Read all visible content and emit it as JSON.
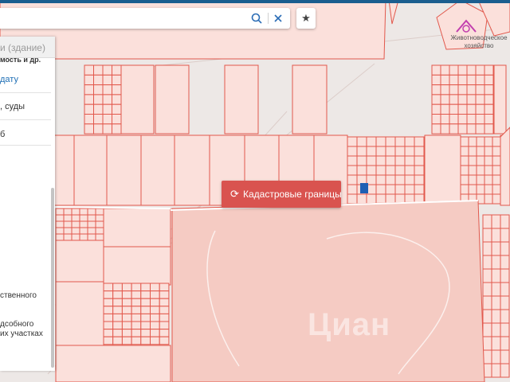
{
  "map": {
    "colors": {
      "background": "#ede8e6",
      "parcel_fill": "#fbe0db",
      "parcel_stroke": "#e2584c",
      "large_parcel_fill": "#f5cbc3",
      "selected_parcel": "#1e5fb4",
      "road_line": "#dccdc9"
    },
    "places": [
      {
        "name": "Животноводческое хозяйство",
        "icon": "livestock-farm-icon"
      }
    ],
    "selected_parcel": true,
    "watermark_text": "Циан"
  },
  "search": {
    "value": "",
    "placeholder": "",
    "search_icon": "magnifier-icon",
    "clear_icon": "close-icon",
    "favorite_icon": "star-icon"
  },
  "panel": {
    "header": "и (здание)",
    "line1": "мость и др.",
    "link": "дату",
    "line2": ", суды",
    "line3": "б",
    "line4": "ственного",
    "line5": "дсобного",
    "line6": "их участках"
  },
  "cadastral_button": {
    "label": "Кадастровые границы",
    "icon": "refresh-icon",
    "accent": "#d9534f"
  },
  "top_accent": "#1b5e8f"
}
